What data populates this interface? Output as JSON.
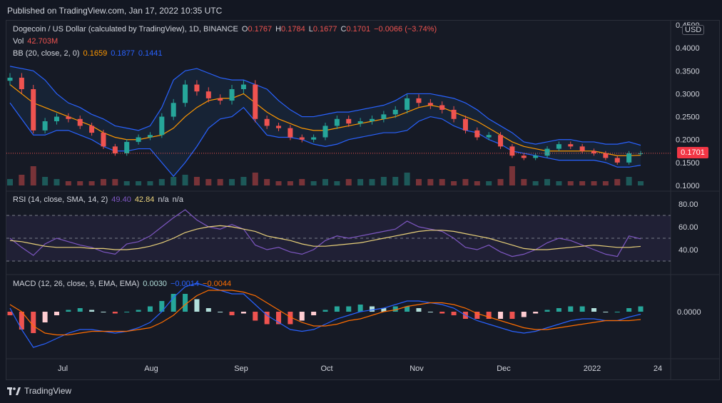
{
  "header": {
    "published": "Published on TradingView.com, Jan 17, 2022 10:35 UTC"
  },
  "footer": {
    "brand": "TradingView"
  },
  "colors": {
    "up": "#26a69a",
    "down": "#ef5350",
    "bb_basis": "#ff9800",
    "bb_band": "#2962ff",
    "rsi": "#7e57c2",
    "rsi_ma": "#e9d17a",
    "macd": "#2962ff",
    "signal": "#ff6d00"
  },
  "legend": {
    "main": {
      "title": "Dogecoin / US Dollar (calculated by TradingView), 1D, BINANCE",
      "o_lab": "O",
      "o": "0.1767",
      "h_lab": "H",
      "h": "0.1784",
      "l_lab": "L",
      "l": "0.1677",
      "c_lab": "C",
      "c": "0.1701",
      "chg": "−0.0066 (−3.74%)"
    },
    "vol": {
      "label": "Vol",
      "value": "42.703M"
    },
    "bb": {
      "label": "BB (20, close, 2, 0)",
      "basis": "0.1659",
      "upper": "0.1877",
      "lower": "0.1441"
    },
    "rsi": {
      "label": "RSI (14, close, SMA, 14, 2)",
      "rsi": "49.40",
      "ma": "42.84",
      "na1": "n/a",
      "na2": "n/a"
    },
    "macd": {
      "label": "MACD (12, 26, close, 9, EMA, EMA)",
      "hist": "0.0030",
      "macd": "−0.0014",
      "signal": "−0.0044"
    }
  },
  "price_scale": {
    "currency": "USD",
    "last_price": "0.1701"
  },
  "chart_data": [
    {
      "type": "candlestick",
      "title": "Dogecoin / US Dollar, 1D, BINANCE",
      "x": [
        "Jun 17",
        "Jun 21",
        "Jun 25",
        "Jun 29",
        "Jul 3",
        "Jul 7",
        "Jul 11",
        "Jul 15",
        "Jul 19",
        "Jul 23",
        "Jul 27",
        "Jul 31",
        "Aug 4",
        "Aug 8",
        "Aug 12",
        "Aug 16",
        "Aug 20",
        "Aug 24",
        "Aug 28",
        "Sep 1",
        "Sep 5",
        "Sep 9",
        "Sep 13",
        "Sep 17",
        "Sep 21",
        "Sep 25",
        "Sep 29",
        "Oct 3",
        "Oct 7",
        "Oct 11",
        "Oct 15",
        "Oct 19",
        "Oct 23",
        "Oct 27",
        "Oct 31",
        "Nov 4",
        "Nov 8",
        "Nov 12",
        "Nov 16",
        "Nov 20",
        "Nov 24",
        "Nov 28",
        "Dec 2",
        "Dec 6",
        "Dec 10",
        "Dec 14",
        "Dec 18",
        "Dec 22",
        "Dec 26",
        "Dec 30",
        "Jan 3",
        "Jan 7",
        "Jan 11",
        "Jan 15",
        "Jan 17"
      ],
      "close": [
        0.335,
        0.31,
        0.22,
        0.24,
        0.25,
        0.245,
        0.23,
        0.215,
        0.185,
        0.17,
        0.195,
        0.205,
        0.21,
        0.25,
        0.28,
        0.32,
        0.305,
        0.29,
        0.285,
        0.31,
        0.32,
        0.245,
        0.23,
        0.225,
        0.205,
        0.2,
        0.205,
        0.23,
        0.245,
        0.235,
        0.24,
        0.245,
        0.255,
        0.265,
        0.29,
        0.28,
        0.275,
        0.265,
        0.245,
        0.22,
        0.205,
        0.21,
        0.185,
        0.165,
        0.16,
        0.165,
        0.18,
        0.19,
        0.185,
        0.175,
        0.17,
        0.16,
        0.15,
        0.17,
        0.1701
      ],
      "volume_rel": [
        0.3,
        0.5,
        0.9,
        0.4,
        0.3,
        0.2,
        0.2,
        0.2,
        0.3,
        0.3,
        0.2,
        0.2,
        0.2,
        0.3,
        0.4,
        0.5,
        0.4,
        0.3,
        0.3,
        0.3,
        0.4,
        0.6,
        0.3,
        0.2,
        0.2,
        0.3,
        0.2,
        0.3,
        0.2,
        0.3,
        0.3,
        0.3,
        0.4,
        0.4,
        0.6,
        0.3,
        0.3,
        0.3,
        0.2,
        0.3,
        0.2,
        0.2,
        0.3,
        0.9,
        0.3,
        0.2,
        0.3,
        0.2,
        0.2,
        0.2,
        0.2,
        0.2,
        0.3,
        0.4,
        0.2
      ],
      "bb_upper": [
        0.36,
        0.355,
        0.35,
        0.33,
        0.3,
        0.28,
        0.27,
        0.255,
        0.245,
        0.23,
        0.225,
        0.22,
        0.23,
        0.27,
        0.33,
        0.35,
        0.355,
        0.345,
        0.335,
        0.33,
        0.33,
        0.32,
        0.31,
        0.285,
        0.265,
        0.25,
        0.25,
        0.255,
        0.26,
        0.26,
        0.265,
        0.27,
        0.275,
        0.285,
        0.3,
        0.3,
        0.3,
        0.295,
        0.29,
        0.28,
        0.265,
        0.245,
        0.23,
        0.215,
        0.195,
        0.19,
        0.195,
        0.2,
        0.2,
        0.195,
        0.195,
        0.19,
        0.19,
        0.195,
        0.1877
      ],
      "bb_basis": [
        0.32,
        0.3,
        0.28,
        0.27,
        0.26,
        0.25,
        0.24,
        0.23,
        0.215,
        0.205,
        0.2,
        0.2,
        0.205,
        0.21,
        0.225,
        0.25,
        0.27,
        0.285,
        0.29,
        0.29,
        0.3,
        0.28,
        0.26,
        0.245,
        0.235,
        0.225,
        0.22,
        0.22,
        0.225,
        0.23,
        0.235,
        0.24,
        0.245,
        0.25,
        0.26,
        0.27,
        0.275,
        0.27,
        0.26,
        0.25,
        0.24,
        0.225,
        0.21,
        0.195,
        0.185,
        0.18,
        0.175,
        0.175,
        0.175,
        0.175,
        0.175,
        0.17,
        0.165,
        0.165,
        0.1659
      ],
      "bb_lower": [
        0.28,
        0.245,
        0.21,
        0.21,
        0.22,
        0.22,
        0.21,
        0.2,
        0.185,
        0.175,
        0.175,
        0.18,
        0.18,
        0.15,
        0.12,
        0.15,
        0.185,
        0.225,
        0.245,
        0.25,
        0.27,
        0.24,
        0.21,
        0.205,
        0.205,
        0.2,
        0.19,
        0.185,
        0.19,
        0.2,
        0.205,
        0.21,
        0.215,
        0.215,
        0.22,
        0.24,
        0.25,
        0.245,
        0.23,
        0.22,
        0.215,
        0.2,
        0.19,
        0.175,
        0.17,
        0.165,
        0.16,
        0.155,
        0.155,
        0.155,
        0.155,
        0.15,
        0.14,
        0.14,
        0.1441
      ],
      "ylim": [
        0.1,
        0.45
      ],
      "y_ticks": [
        "0.1000",
        "0.1500",
        "0.2000",
        "0.2500",
        "0.3000",
        "0.3500",
        "0.4000",
        "0.4500"
      ],
      "x_tick_labels": [
        "Jul",
        "Aug",
        "Sep",
        "Oct",
        "Nov",
        "Dec",
        "2022",
        "24"
      ]
    },
    {
      "type": "line",
      "title": "RSI (14, close, SMA, 14, 2)",
      "series": [
        {
          "values": [
            50,
            42,
            35,
            45,
            50,
            47,
            44,
            42,
            38,
            36,
            45,
            47,
            52,
            60,
            68,
            75,
            66,
            60,
            58,
            62,
            58,
            44,
            40,
            42,
            38,
            36,
            40,
            48,
            52,
            50,
            52,
            54,
            56,
            58,
            65,
            60,
            58,
            56,
            50,
            42,
            40,
            44,
            38,
            34,
            36,
            40,
            46,
            50,
            48,
            44,
            40,
            36,
            34,
            52,
            49.4
          ]
        },
        {
          "values": [
            48,
            47,
            45,
            43,
            42,
            42,
            42,
            41,
            41,
            40,
            40,
            41,
            43,
            46,
            50,
            55,
            58,
            60,
            61,
            60,
            58,
            56,
            52,
            50,
            48,
            45,
            43,
            43,
            44,
            45,
            46,
            48,
            50,
            52,
            54,
            56,
            57,
            57,
            56,
            54,
            52,
            50,
            47,
            44,
            41,
            40,
            40,
            41,
            42,
            43,
            44,
            43,
            42,
            42,
            42.84
          ]
        }
      ],
      "y_ticks": [
        "40.00",
        "60.00",
        "80.00"
      ]
    },
    {
      "type": "line",
      "title": "MACD (12, 26, close, 9, EMA, EMA)",
      "series": [
        {
          "values": [
            0.002,
            -0.01,
            -0.02,
            -0.018,
            -0.015,
            -0.012,
            -0.01,
            -0.01,
            -0.011,
            -0.012,
            -0.011,
            -0.009,
            -0.006,
            0,
            0.008,
            0.014,
            0.016,
            0.014,
            0.012,
            0.01,
            0.01,
            0.004,
            -0.002,
            -0.006,
            -0.01,
            -0.011,
            -0.01,
            -0.007,
            -0.004,
            -0.002,
            0,
            0.001,
            0.002,
            0.004,
            0.006,
            0.006,
            0.005,
            0.004,
            0.002,
            -0.002,
            -0.005,
            -0.007,
            -0.009,
            -0.011,
            -0.012,
            -0.011,
            -0.009,
            -0.007,
            -0.005,
            -0.004,
            -0.004,
            -0.005,
            -0.005,
            -0.003,
            -0.0014
          ]
        },
        {
          "values": [
            0.004,
            0,
            -0.008,
            -0.012,
            -0.013,
            -0.013,
            -0.012,
            -0.011,
            -0.011,
            -0.011,
            -0.011,
            -0.01,
            -0.009,
            -0.006,
            -0.002,
            0.004,
            0.009,
            0.012,
            0.012,
            0.012,
            0.011,
            0.009,
            0.005,
            0.001,
            -0.003,
            -0.006,
            -0.008,
            -0.008,
            -0.007,
            -0.005,
            -0.004,
            -0.002,
            0,
            0.001,
            0.003,
            0.004,
            0.005,
            0.005,
            0.004,
            0.002,
            -0.001,
            -0.003,
            -0.005,
            -0.007,
            -0.009,
            -0.01,
            -0.01,
            -0.009,
            -0.008,
            -0.007,
            -0.006,
            -0.005,
            -0.005,
            -0.005,
            -0.0044
          ]
        }
      ],
      "y_ticks": [
        "0.0000"
      ]
    }
  ]
}
